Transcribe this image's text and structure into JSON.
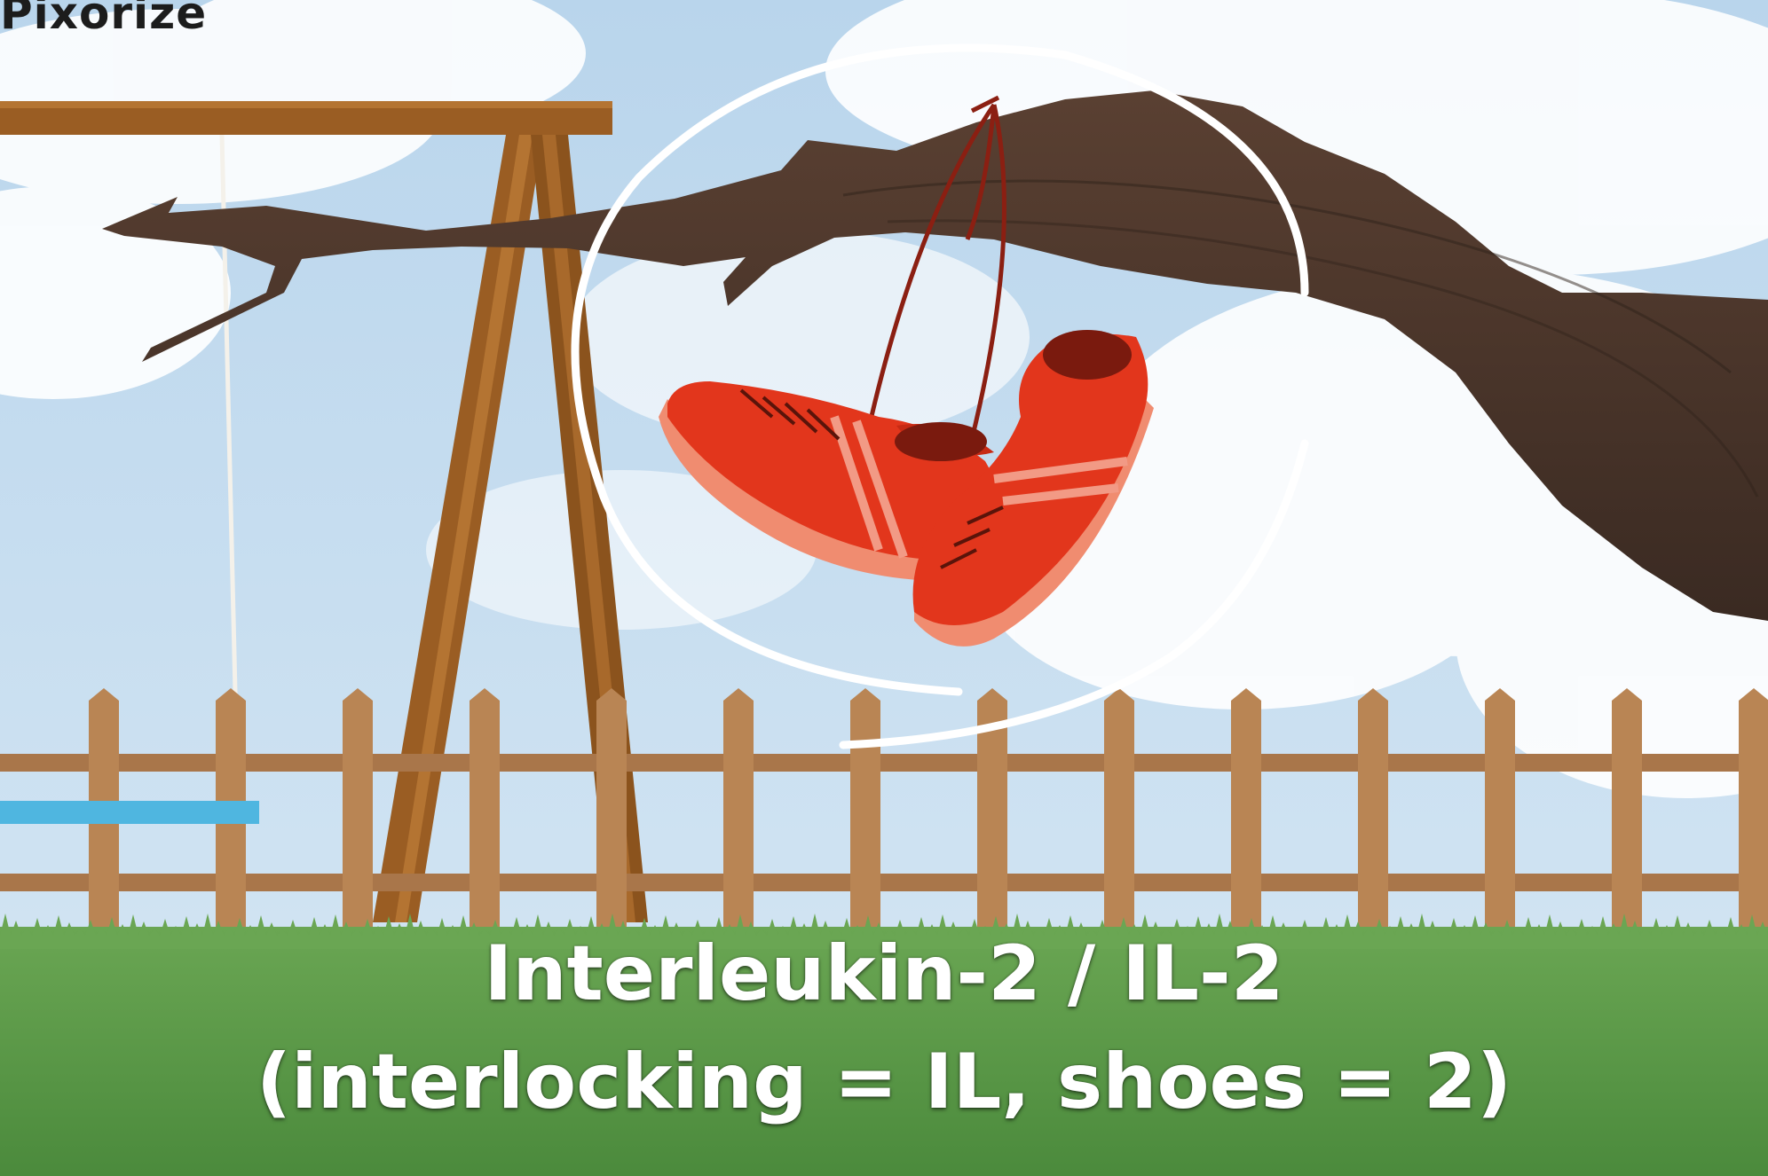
{
  "brand": {
    "name": "Pixorize"
  },
  "caption": {
    "line1": "Interleukin-2 / IL-2",
    "line2": "(interlocking = IL, shoes = 2)"
  },
  "scene": {
    "subject": "pair of red sneakers hanging by their laces from a tree branch",
    "highlight": "white hand-drawn circle around the shoes",
    "background_elements": [
      "sky with clouds",
      "wooden swing set",
      "wooden picket fence",
      "grass lawn",
      "tree branch",
      "blue swing seat"
    ]
  },
  "colors": {
    "sky": "#c9dff0",
    "grass": "#5c9a45",
    "fence": "#b98554",
    "swing_wood": "#9a5d23",
    "branch": "#4a3428",
    "shoe": "#e2361c",
    "shoe_sole": "#f08c70",
    "swing_seat": "#4fb6e0",
    "highlight": "#ffffff",
    "caption_text": "#ffffff"
  }
}
